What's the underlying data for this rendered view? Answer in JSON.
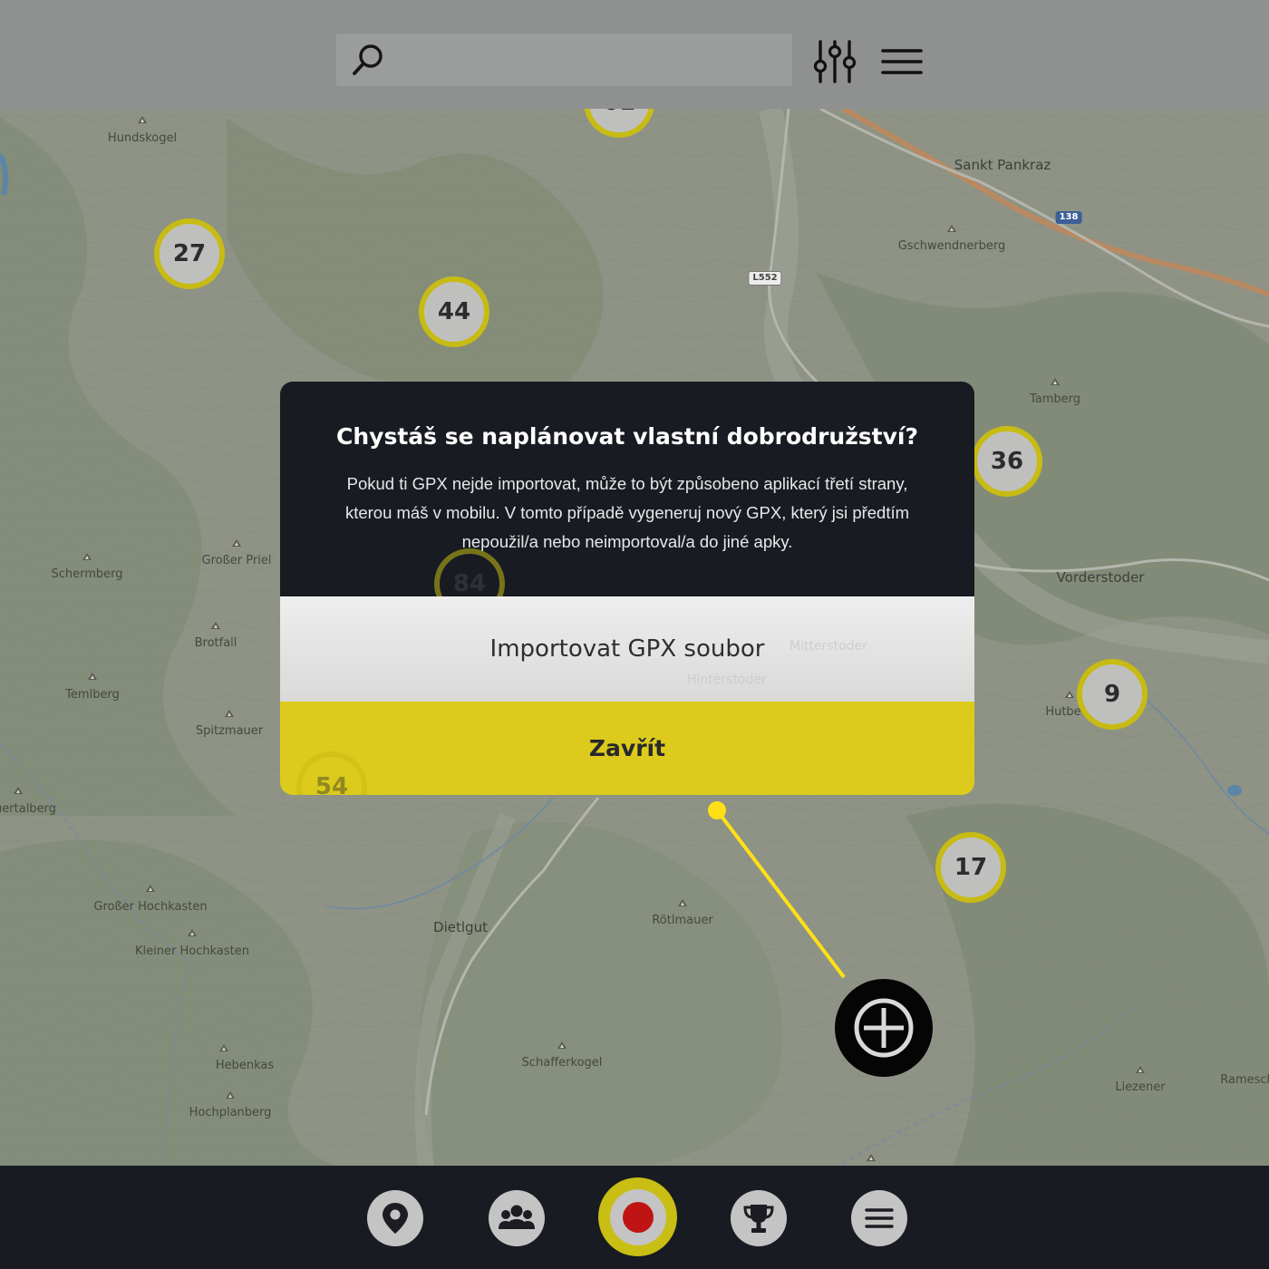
{
  "search": {
    "value": "",
    "placeholder": ""
  },
  "topbar": {
    "filter_icon": "sliders-icon",
    "menu_icon": "hamburger-icon"
  },
  "map": {
    "places": {
      "hundskogel": "Hundskogel",
      "sankt_pankraz": "Sankt Pankraz",
      "gschwendnerberg": "Gschwendnerberg",
      "tamberg": "Tamberg",
      "vorderstoder": "Vorderstoder",
      "schermberg": "Schermberg",
      "grosser_priel": "Großer Priel",
      "brotfall": "Brotfall",
      "temlberg": "Temlberg",
      "spitzmauer": "Spitzmauer",
      "huetterbeg": "Hutbe",
      "mitterstoder": "Mitterstoder",
      "hinterstoder": "Hinterstoder",
      "quertalberg": "uertalberg",
      "grosser_hochkasten": "Großer Hochkasten",
      "kleiner_hochkasten": "Kleiner Hochkasten",
      "dietlgut": "Dietlgut",
      "rotlmauer": "Rötlmauer",
      "hebenkas": "Hebenkas",
      "hochplanberg": "Hochplanberg",
      "schafferkogel": "Schafferkogel",
      "liezener": "Liezener",
      "ramesch": "Ramesch"
    },
    "roads": {
      "l552": "L552",
      "r138": "138"
    },
    "clusters": {
      "c61": "61",
      "c27": "27",
      "c44": "44",
      "c36": "36",
      "c84": "84",
      "c9": "9",
      "c54": "54",
      "c17": "17"
    }
  },
  "modal": {
    "title": "Chystáš se naplánovat vlastní dobrodružství?",
    "text": "Pokud ti GPX nejde importovat, může to být způsobeno aplikací třetí strany, kterou máš v mobilu. V tomto případě vygeneruj nový GPX, který jsi předtím nepoužil/a nebo neimportoval/a do jiné apky.",
    "import_label": "Importovat GPX soubor",
    "close_label": "Zavřít"
  },
  "add_button": {
    "icon": "plus-icon"
  },
  "bottom_nav": {
    "items": [
      {
        "icon": "map-pin-icon"
      },
      {
        "icon": "group-icon"
      },
      {
        "icon": "record-icon"
      },
      {
        "icon": "trophy-icon"
      },
      {
        "icon": "menu-icon"
      }
    ]
  },
  "colors": {
    "accent": "#dccb1c",
    "dark": "#181b22",
    "record": "#c01414"
  }
}
